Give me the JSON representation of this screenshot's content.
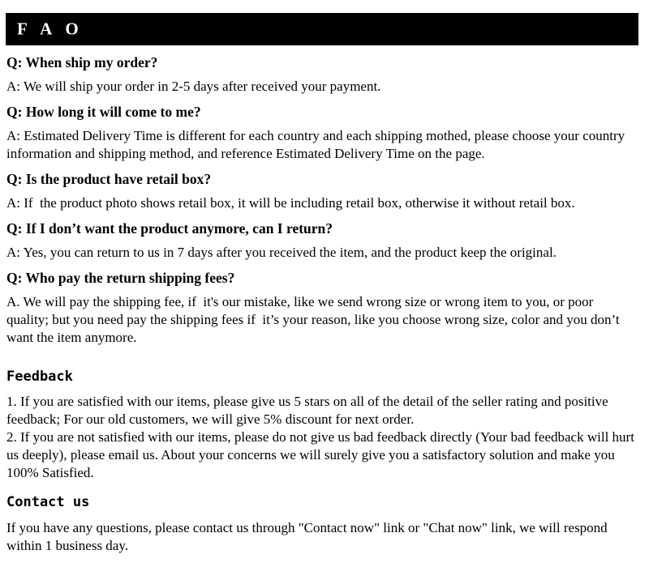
{
  "banner": {
    "title": "F A O"
  },
  "faq": [
    {
      "question": "Q: When ship my order?",
      "answer": "A: We will ship your order in 2-5 days after received your payment."
    },
    {
      "question": "Q: How long it will come to me?",
      "answer": "A: Estimated Delivery Time is different for each country and each shipping mothed, please choose your country information and shipping method, and reference Estimated Delivery Time on the page."
    },
    {
      "question": "Q: Is the product have retail box?",
      "answer": "A: If  the product photo shows retail box, it will be including retail box, otherwise it without retail box."
    },
    {
      "question": "Q: If I don’t want the product anymore, can I return?",
      "answer": "A: Yes, you can return to us in 7 days after you received the item, and the product keep the original."
    },
    {
      "question": "Q: Who pay the return shipping fees?",
      "answer": "A. We will pay the shipping fee, if  it's our mistake, like we send wrong size or wrong item to you, or poor quality; but you need pay the shipping fees if  it’s your reason, like you choose wrong size, color and you don’t want the item anymore."
    }
  ],
  "feedback": {
    "heading": "Feedback",
    "items": [
      "1.  If you are satisfied with our items, please give us 5 stars on all of the detail of the seller rating and positive feedback; For our old customers, we will give 5% discount for next order.",
      "2.  If you are not satisfied with our items, please do not give us bad feedback directly (Your bad feedback will hurt us deeply), please email us. About your concerns we will surely give you a satisfactory solution and make you 100% Satisfied."
    ]
  },
  "contact": {
    "heading": "Contact us",
    "body": "If you have any questions, please contact us through \"Contact now\" link or \"Chat now\" link, we will respond within 1 business day."
  },
  "colors": {
    "banner_background": "#000000",
    "banner_text": "#ffffff",
    "page_background": "#ffffff",
    "body_text": "#000000"
  }
}
